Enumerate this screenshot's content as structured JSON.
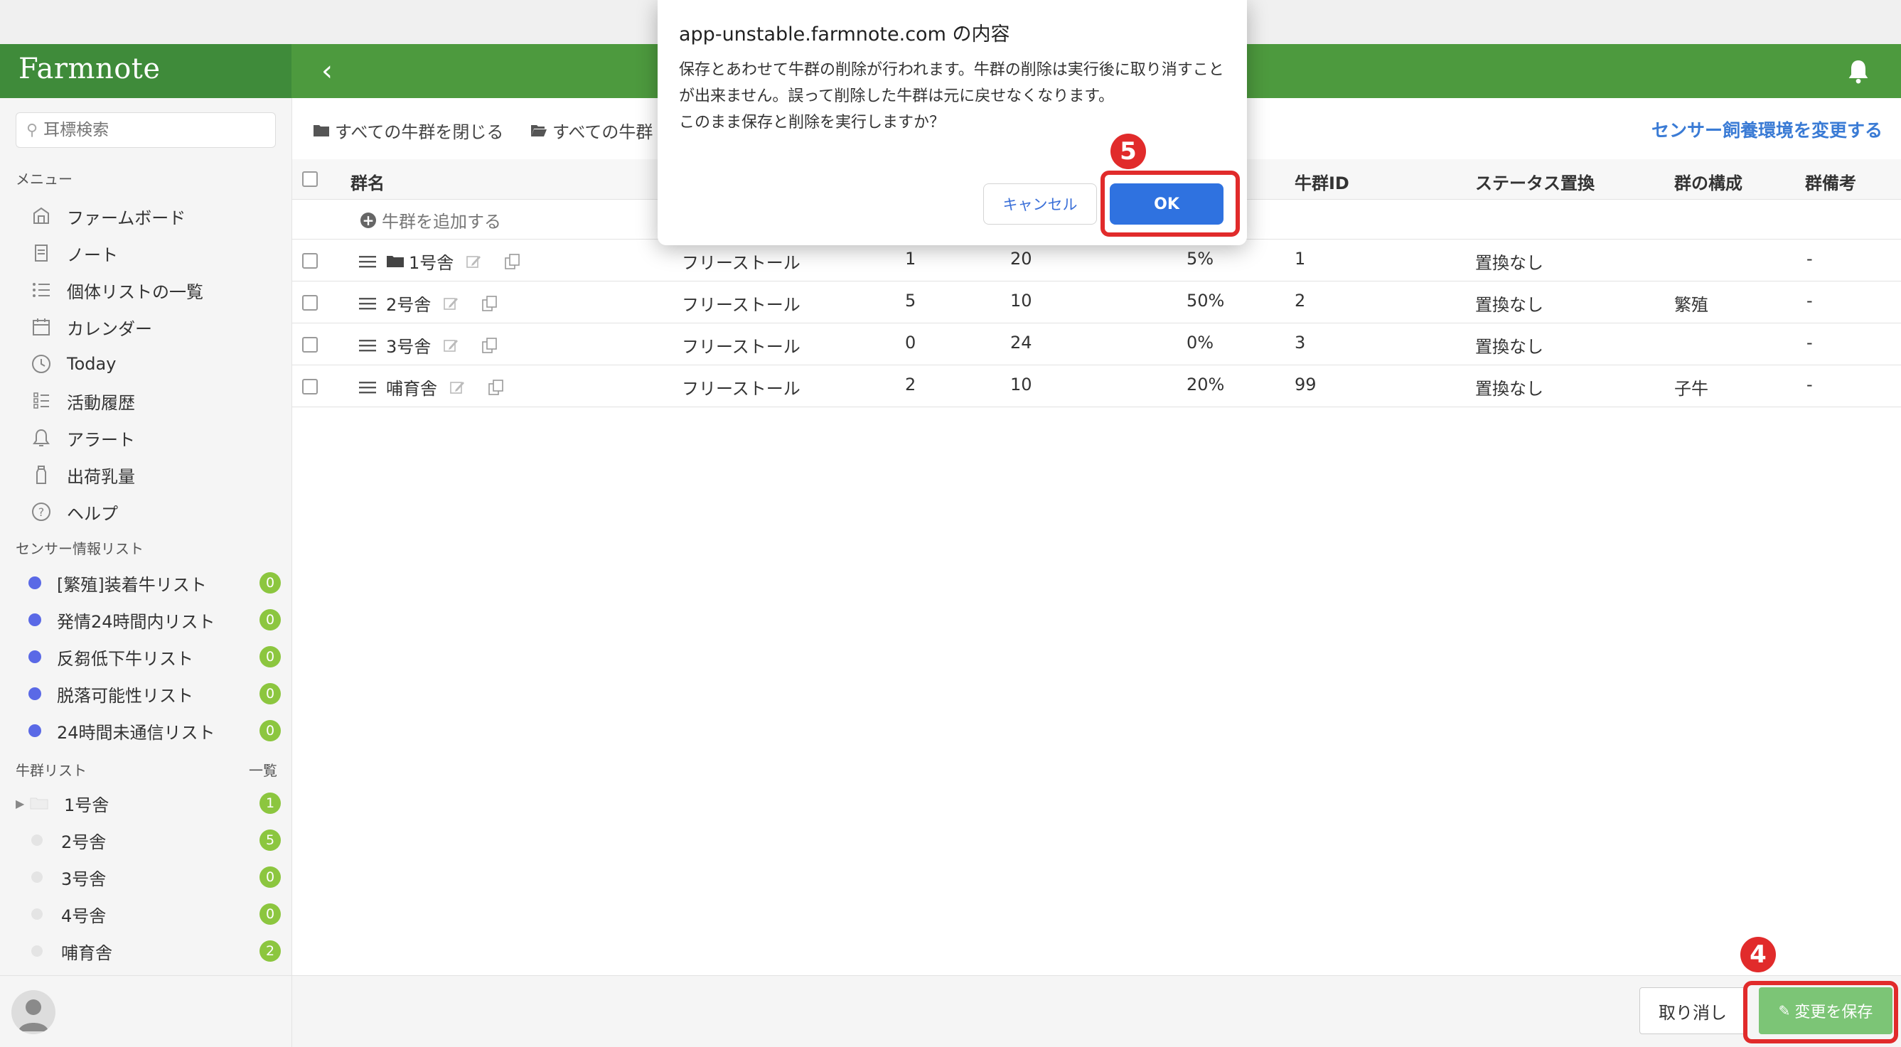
{
  "app": {
    "logo": "Farmnote"
  },
  "dialog": {
    "title": "app-unstable.farmnote.com の内容",
    "message": "保存とあわせて牛群の削除が行われます。牛群の削除は実行後に取り消すことが出来ません。誤って削除した牛群は元に戻せなくなります。\nこのまま保存と削除を実行しますか？",
    "cancel_label": "キャンセル",
    "ok_label": "OK"
  },
  "sidebar": {
    "search_placeholder": "耳標検索",
    "menu_title": "メニュー",
    "menu": [
      {
        "label": "ファームボード",
        "icon": "farmboard-icon"
      },
      {
        "label": "ノート",
        "icon": "note-icon"
      },
      {
        "label": "個体リストの一覧",
        "icon": "list-icon"
      },
      {
        "label": "カレンダー",
        "icon": "calendar-icon"
      },
      {
        "label": "Today",
        "icon": "clock-icon"
      },
      {
        "label": "活動履歴",
        "icon": "activity-icon"
      },
      {
        "label": "アラート",
        "icon": "bell-icon"
      },
      {
        "label": "出荷乳量",
        "icon": "milk-bottle-icon"
      },
      {
        "label": "ヘルプ",
        "icon": "help-icon"
      }
    ],
    "sensor_title": "センサー情報リスト",
    "sensor_lists": [
      {
        "label": "[繁殖]装着牛リスト",
        "count": "0"
      },
      {
        "label": "発情24時間内リスト",
        "count": "0"
      },
      {
        "label": "反芻低下牛リスト",
        "count": "0"
      },
      {
        "label": "脱落可能性リスト",
        "count": "0"
      },
      {
        "label": "24時間未通信リスト",
        "count": "0"
      }
    ],
    "herd_title": "牛群リスト",
    "herd_all": "一覧",
    "herds": [
      {
        "label": "1号舎",
        "count": "1"
      },
      {
        "label": "2号舎",
        "count": "5"
      },
      {
        "label": "3号舎",
        "count": "0"
      },
      {
        "label": "4号舎",
        "count": "0"
      },
      {
        "label": "哺育舎",
        "count": "2"
      }
    ]
  },
  "toolbar": {
    "close_all": "すべての牛群を閉じる",
    "open_all": "すべての牛群",
    "sensor_link": "センサー飼養環境を変更する"
  },
  "table": {
    "headers": {
      "name": "群名",
      "herd_id": "牛群ID",
      "status": "ステータス置換",
      "composition": "群の構成",
      "note": "群備考"
    },
    "add_label": "牛群を追加する",
    "rows": [
      {
        "name": "1号舎",
        "type": "フリーストール",
        "c1": "1",
        "c2": "20",
        "pct": "5%",
        "id": "1",
        "status": "置換なし",
        "composition": "",
        "note": "-"
      },
      {
        "name": "2号舎",
        "type": "フリーストール",
        "c1": "5",
        "c2": "10",
        "pct": "50%",
        "id": "2",
        "status": "置換なし",
        "composition": "繁殖",
        "note": "-"
      },
      {
        "name": "3号舎",
        "type": "フリーストール",
        "c1": "0",
        "c2": "24",
        "pct": "0%",
        "id": "3",
        "status": "置換なし",
        "composition": "",
        "note": "-"
      },
      {
        "name": "哺育舎",
        "type": "フリーストール",
        "c1": "2",
        "c2": "10",
        "pct": "20%",
        "id": "99",
        "status": "置換なし",
        "composition": "子牛",
        "note": "-"
      }
    ]
  },
  "footer": {
    "cancel_label": "取り消し",
    "save_label": "変更を保存"
  },
  "annotations": {
    "step_ok": "5",
    "step_save": "4"
  },
  "colors": {
    "brand": "#3f8b3a",
    "header": "#4d9a3e",
    "primary": "#2f72e0",
    "badge": "#8cc63f",
    "highlight": "#e12b2b",
    "save": "#7cc576"
  }
}
